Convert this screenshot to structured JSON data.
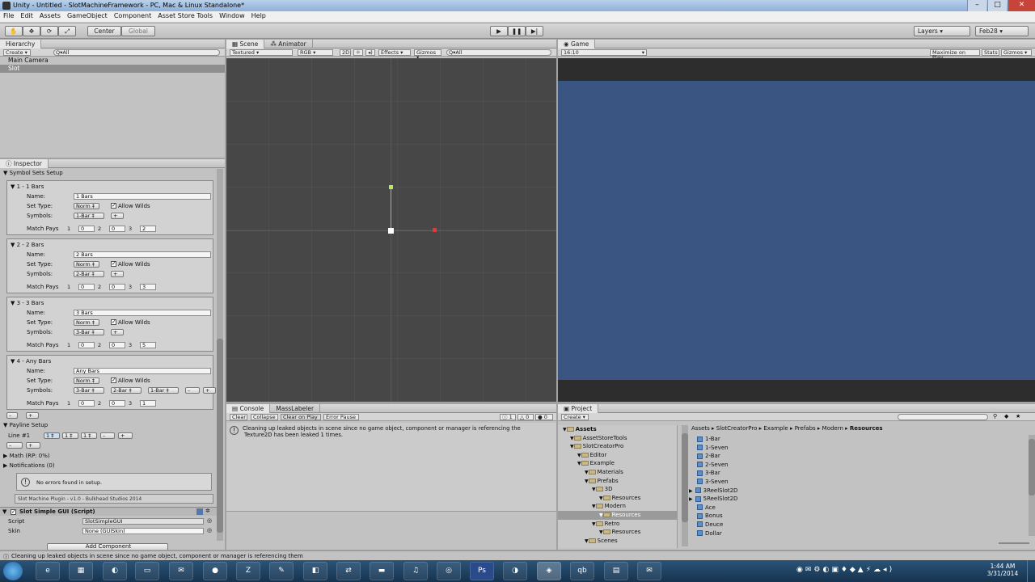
{
  "window": {
    "title": "Unity - Untitled - SlotMachineFramework - PC, Mac & Linux Standalone*"
  },
  "menu": [
    "File",
    "Edit",
    "Assets",
    "GameObject",
    "Component",
    "Asset Store Tools",
    "Window",
    "Help"
  ],
  "toolbar": {
    "center": "Center",
    "global": "Global",
    "layers": "Layers",
    "layout": "Feb28"
  },
  "hierarchy": {
    "tab": "Hierarchy",
    "create": "Create",
    "search": "Q▾All",
    "items": [
      "Main Camera",
      "Slot"
    ]
  },
  "scene": {
    "tab_scene": "Scene",
    "tab_animator": "Animator",
    "textured": "Textured",
    "rgb": "RGB",
    "mode2d": "2D",
    "effects": "Effects",
    "gizmos": "Gizmos",
    "search": "Q▾All"
  },
  "game": {
    "tab": "Game",
    "aspect": "16:10",
    "maximize": "Maximize on Play",
    "stats": "Stats",
    "gizmos": "Gizmos"
  },
  "inspector": {
    "tab": "Inspector",
    "section": "Symbol Sets Setup",
    "labels": {
      "name": "Name:",
      "set_type": "Set Type:",
      "symbols": "Symbols:",
      "match_pays": "Match Pays",
      "allow_wilds": "Allow Wilds"
    },
    "sets": [
      {
        "header": "1 - 1 Bars",
        "name": "1 Bars",
        "type": "Norm",
        "symbols": [
          "1-Bar"
        ],
        "pays": [
          "0",
          "0",
          "2"
        ]
      },
      {
        "header": "2 - 2 Bars",
        "name": "2 Bars",
        "type": "Norm",
        "symbols": [
          "2-Bar"
        ],
        "pays": [
          "0",
          "0",
          "3"
        ]
      },
      {
        "header": "3 - 3 Bars",
        "name": "3 Bars",
        "type": "Norm",
        "symbols": [
          "3-Bar"
        ],
        "pays": [
          "0",
          "0",
          "5"
        ]
      },
      {
        "header": "4 - Any Bars",
        "name": "Any Bars",
        "type": "Norm",
        "symbols": [
          "3-Bar",
          "2-Bar",
          "1-Bar"
        ],
        "pays": [
          "0",
          "0",
          "1"
        ]
      }
    ],
    "payline_setup": "Payline Setup",
    "line1": "Line #1",
    "math": "Math (RP: 0%)",
    "notifications": "Notifications (0)",
    "no_errors": "No errors found in setup.",
    "credit": "Slot Machine Plugin - v1.0 - Bulkhead Studios 2014",
    "component": "Slot Simple GUI (Script)",
    "script_label": "Script",
    "script_value": "SlotSimpleGUI",
    "skin_label": "Skin",
    "skin_value": "None (GUISkin)",
    "add_component": "Add Component"
  },
  "console": {
    "tab": "Console",
    "tab2": "MassLabeler",
    "buttons": [
      "Clear",
      "Collapse",
      "Clear on Play",
      "Error Pause"
    ],
    "counts": [
      "1",
      "0",
      "0"
    ],
    "message_line1": "Cleaning up leaked objects in scene since no game object, component or manager is referencing the",
    "message_line2": "Texture2D  has been leaked 1 times."
  },
  "project": {
    "tab": "Project",
    "create": "Create",
    "tree": [
      {
        "label": "Assets",
        "indent": 0,
        "bold": true
      },
      {
        "label": "AssetStoreTools",
        "indent": 1
      },
      {
        "label": "SlotCreatorPro",
        "indent": 1
      },
      {
        "label": "Editor",
        "indent": 2
      },
      {
        "label": "Example",
        "indent": 2
      },
      {
        "label": "Materials",
        "indent": 3
      },
      {
        "label": "Prefabs",
        "indent": 3
      },
      {
        "label": "3D",
        "indent": 4
      },
      {
        "label": "Resources",
        "indent": 5
      },
      {
        "label": "Modern",
        "indent": 4
      },
      {
        "label": "Resources",
        "indent": 5,
        "selected": true
      },
      {
        "label": "Retro",
        "indent": 4
      },
      {
        "label": "Resources",
        "indent": 5
      },
      {
        "label": "Scenes",
        "indent": 3
      }
    ],
    "breadcrumb": [
      "Assets",
      "SlotCreatorPro",
      "Example",
      "Prefabs",
      "Modern",
      "Resources"
    ],
    "files": [
      "1-Bar",
      "1-Seven",
      "2-Bar",
      "2-Seven",
      "3-Bar",
      "3-Seven",
      "3ReelSlot2D",
      "5ReelSlot2D",
      "Ace",
      "Bonus",
      "Deuce",
      "Dollar"
    ]
  },
  "statusbar": "Cleaning up leaked objects in scene since no game object, component or manager is referencing them",
  "clock": {
    "time": "1:44 AM",
    "date": "3/31/2014"
  },
  "colors": {
    "game_bg": "#3a5582",
    "scene_bg": "#474747",
    "panel": "#c2c2c2"
  }
}
